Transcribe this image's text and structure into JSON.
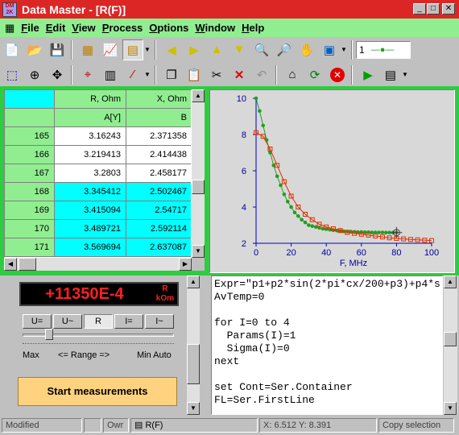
{
  "window": {
    "title": "Data Master - [R(F)]",
    "app_icon": "DM 2K"
  },
  "menu": [
    "File",
    "Edit",
    "View",
    "Process",
    "Options",
    "Window",
    "Help"
  ],
  "toolbar1": {
    "icons": [
      "new-file-icon",
      "open-folder-icon",
      "save-icon",
      "grid-icon",
      "chart-icon",
      "chart-edit-icon",
      "arrow-left-icon",
      "arrow-right-icon",
      "arrow-up-icon",
      "arrow-down-icon",
      "zoom-in-icon",
      "zoom-out-icon",
      "hand-icon",
      "paint-icon"
    ],
    "combo_value": "1"
  },
  "toolbar2": {
    "icons": [
      "select-rect-icon",
      "target-icon",
      "move-icon",
      "crosshair-icon",
      "calculator-icon",
      "line-icon",
      "copy-icon",
      "paste-icon",
      "cut-icon",
      "delete-icon",
      "undo-icon",
      "home-icon",
      "refresh-icon",
      "stop-icon",
      "run-icon",
      "run-menu-icon"
    ]
  },
  "grid": {
    "headers": [
      "",
      "R, Ohm",
      "X, Ohm"
    ],
    "subheaders": [
      "",
      "A[Y]",
      "B"
    ],
    "rows": [
      {
        "n": "165",
        "a": "3.16243",
        "b": "2.371358",
        "sel": false
      },
      {
        "n": "166",
        "a": "3.219413",
        "b": "2.414438",
        "sel": false
      },
      {
        "n": "167",
        "a": "3.2803",
        "b": "2.458177",
        "sel": false
      },
      {
        "n": "168",
        "a": "3.345412",
        "b": "2.502467",
        "sel": true
      },
      {
        "n": "169",
        "a": "3.415094",
        "b": "2.54717",
        "sel": true
      },
      {
        "n": "170",
        "a": "3.489721",
        "b": "2.592114",
        "sel": true
      },
      {
        "n": "171",
        "a": "3.569694",
        "b": "2.637087",
        "sel": true
      }
    ]
  },
  "chart_data": {
    "type": "scatter",
    "title": "",
    "xlabel": "F, MHz",
    "ylabel": "",
    "xlim": [
      0,
      100
    ],
    "ylim": [
      2,
      10
    ],
    "xticks": [
      0,
      20,
      40,
      60,
      80,
      100
    ],
    "yticks": [
      2,
      4,
      6,
      8,
      10
    ],
    "grid": false,
    "colors": {
      "green": "#20a020",
      "red": "#e03000"
    },
    "series": [
      {
        "color": "green",
        "x": [
          0,
          2,
          4,
          6,
          8,
          10,
          12,
          14,
          16,
          18,
          20,
          22,
          24,
          26,
          28,
          30,
          32,
          34,
          36,
          38,
          40,
          42,
          44,
          46,
          48,
          50,
          52,
          54,
          56,
          58,
          60,
          62,
          64,
          66,
          68,
          70,
          72,
          74,
          76,
          78,
          80
        ],
        "y": [
          10,
          9.3,
          8.5,
          7.7,
          7.0,
          6.3,
          5.7,
          5.2,
          4.7,
          4.3,
          4.0,
          3.7,
          3.5,
          3.3,
          3.15,
          3.0,
          2.95,
          2.9,
          2.85,
          2.8,
          2.78,
          2.75,
          2.72,
          2.7,
          2.68,
          2.66,
          2.65,
          2.64,
          2.63,
          2.62,
          2.62,
          2.61,
          2.61,
          2.6,
          2.6,
          2.6,
          2.6,
          2.59,
          2.59,
          2.59,
          2.59
        ]
      },
      {
        "color": "red",
        "x": [
          0,
          4,
          8,
          12,
          16,
          20,
          24,
          28,
          32,
          36,
          40,
          44,
          48,
          52,
          56,
          60,
          64,
          68,
          72,
          76,
          80,
          84,
          88,
          92,
          96,
          100
        ],
        "y": [
          8.1,
          7.9,
          7.2,
          6.3,
          5.4,
          4.6,
          4.0,
          3.6,
          3.3,
          3.05,
          2.9,
          2.8,
          2.7,
          2.6,
          2.55,
          2.5,
          2.45,
          2.4,
          2.35,
          2.3,
          2.27,
          2.24,
          2.21,
          2.19,
          2.17,
          2.15
        ]
      }
    ]
  },
  "meter": {
    "value": "+11350E-4",
    "unit_top": "R",
    "unit_bottom": "kOm",
    "modes": [
      "U=",
      "U~",
      "R",
      "I=",
      "I~"
    ],
    "pressed_mode": "R",
    "range_left": "Max",
    "range_center": "<= Range =>",
    "range_right": "Min Auto",
    "start_label": "Start measurements"
  },
  "script": {
    "lines": [
      "Expr=\"p1+p2*sin(2*pi*cx/200+p3)+p4*s",
      "AvTemp=0",
      "",
      "for I=0 to 4",
      "  Params(I)=1",
      "  Sigma(I)=0",
      "next",
      "",
      "set Cont=Ser.Container",
      "FL=Ser.FirstLine"
    ]
  },
  "statusbar": {
    "modified": "Modified",
    "mode": "Owr",
    "doc": "R(F)",
    "coords": "X: 6.512 Y: 8.391",
    "action": "Copy selection"
  }
}
